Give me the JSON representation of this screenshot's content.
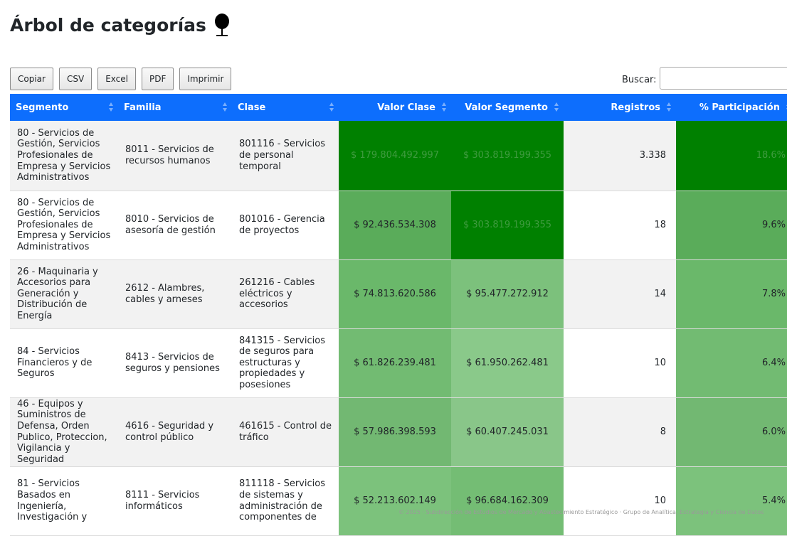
{
  "page": {
    "title": "Árbol de categorías",
    "title_icon": "tree-icon"
  },
  "toolbar": {
    "buttons": [
      "Copiar",
      "CSV",
      "Excel",
      "PDF",
      "Imprimir"
    ],
    "search_label": "Buscar:",
    "search_value": ""
  },
  "table": {
    "headers": [
      "Segmento",
      "Familia",
      "Clase",
      "Valor Clase",
      "Valor Segmento",
      "Registros",
      "% Participación"
    ],
    "rows": [
      {
        "segmento": "80 - Servicios de Gestión, Servicios Profesionales de Empresa y Servicios Administrativos",
        "familia": "8011 - Servicios de recursos humanos",
        "clase": "801116 - Servicios de personal temporal",
        "valor_clase": "$ 179.804.492.997",
        "valor_segmento": "$ 303.819.199.355",
        "registros": "3.338",
        "participacion": "18.6%",
        "clase_color": "#008000",
        "segmento_color": "#008000",
        "part_color": "#008000",
        "clase_text_color": "#3f9b3f",
        "segmento_text_color": "#3f9b3f",
        "part_text_color": "#3f9b3f"
      },
      {
        "segmento": "80 - Servicios de Gestión, Servicios Profesionales de Empresa y Servicios Administrativos",
        "familia": "8010 - Servicios de asesoría de gestión",
        "clase": "801016 - Gerencia de proyectos",
        "valor_clase": "$ 92.436.534.308",
        "valor_segmento": "$ 303.819.199.355",
        "registros": "18",
        "participacion": "9.6%",
        "clase_color": "#5aac5a",
        "segmento_color": "#008000",
        "part_color": "#5aac5a",
        "clase_text_color": "#212529",
        "segmento_text_color": "#3f9b3f",
        "part_text_color": "#212529"
      },
      {
        "segmento": "26 - Maquinaria y Accesorios para Generación y Distribución de Energía",
        "familia": "2612 - Alambres, cables y arneses",
        "clase": "261216 - Cables eléctricos y accesorios",
        "valor_clase": "$ 74.813.620.586",
        "valor_segmento": "$ 95.477.272.912",
        "registros": "14",
        "participacion": "7.8%",
        "clase_color": "#6ab86a",
        "segmento_color": "#7cc17c",
        "part_color": "#6ab86a",
        "clase_text_color": "#212529",
        "segmento_text_color": "#212529",
        "part_text_color": "#212529"
      },
      {
        "segmento": "84 - Servicios Financieros y de Seguros",
        "familia": "8413 - Servicios de seguros y pensiones",
        "clase": "841315 - Servicios de seguros para estructuras y propiedades y posesiones",
        "valor_clase": "$ 61.826.239.481",
        "valor_segmento": "$ 61.950.262.481",
        "registros": "10",
        "participacion": "6.4%",
        "clase_color": "#72bb72",
        "segmento_color": "#8ac98a",
        "part_color": "#72bb72",
        "clase_text_color": "#212529",
        "segmento_text_color": "#212529",
        "part_text_color": "#212529"
      },
      {
        "segmento": "46 - Equipos y Suministros de Defensa, Orden Publico, Proteccion, Vigilancia y Seguridad",
        "familia": "4616 - Seguridad y control público",
        "clase": "461615 - Control de tráfico",
        "valor_clase": "$ 57.986.398.593",
        "valor_segmento": "$ 60.407.245.031",
        "registros": "8",
        "participacion": "6.0%",
        "clase_color": "#72b872",
        "segmento_color": "#89c689",
        "part_color": "#72b872",
        "clase_text_color": "#212529",
        "segmento_text_color": "#212529",
        "part_text_color": "#212529"
      },
      {
        "segmento": "81 - Servicios Basados en Ingeniería, Investigación y",
        "familia": "8111 - Servicios informáticos",
        "clase": "811118 - Servicios de sistemas y administración de componentes de",
        "valor_clase": "$ 52.213.602.149",
        "valor_segmento": "$ 96.684.162.309",
        "registros": "10",
        "participacion": "5.4%",
        "clase_color": "#7cc27c",
        "segmento_color": "#74bd74",
        "part_color": "#7cc27c",
        "clase_text_color": "#212529",
        "segmento_text_color": "#212529",
        "part_text_color": "#212529"
      }
    ]
  },
  "footer": {
    "text": "© 2025 · Subdirección de Estudios de Mercado y Abastecimiento Estratégico · Grupo de Analítica, Estrategia y Ciencia de Datos"
  }
}
